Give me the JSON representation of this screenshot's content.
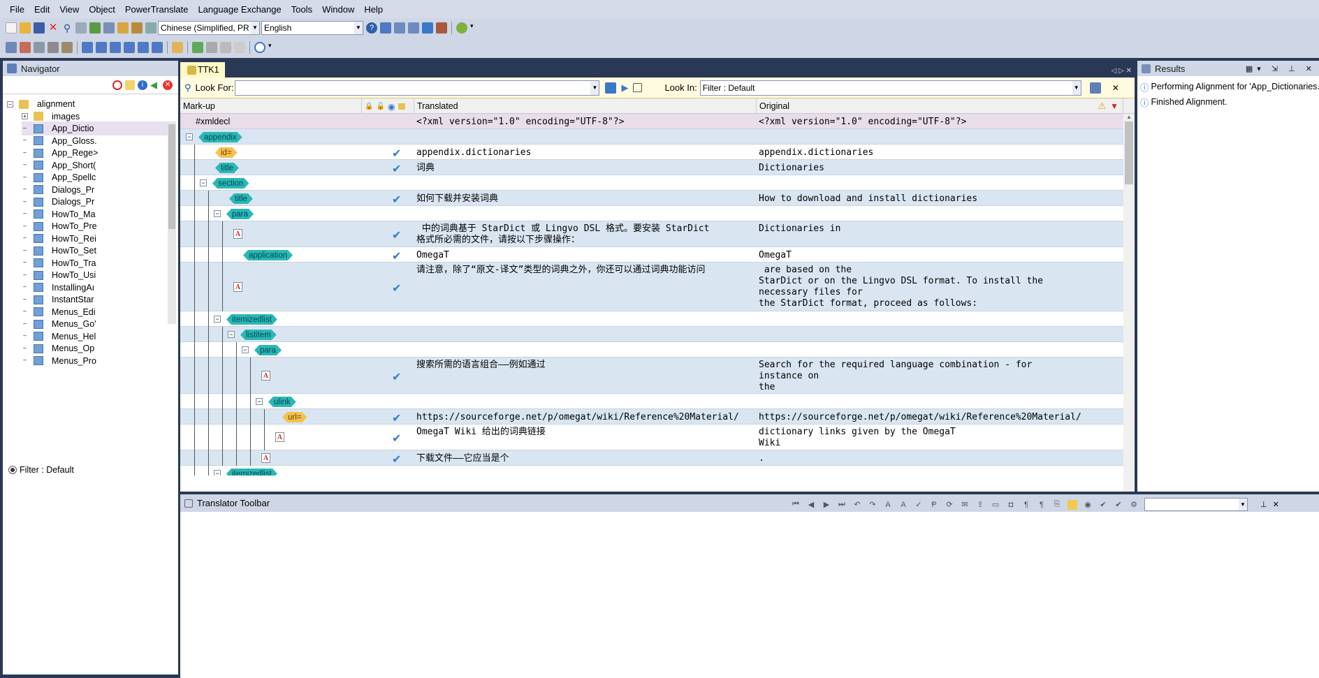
{
  "menu": [
    "File",
    "Edit",
    "View",
    "Object",
    "PowerTranslate",
    "Language Exchange",
    "Tools",
    "Window",
    "Help"
  ],
  "toolbar": {
    "source_lang": "Chinese (Simplified, PR",
    "target_lang": "English"
  },
  "navigator": {
    "title": "Navigator",
    "tree": [
      {
        "label": "alignment",
        "kind": "folder",
        "level": 0
      },
      {
        "label": "images",
        "kind": "folder",
        "level": 1
      },
      {
        "label": "App_Dictio",
        "kind": "file",
        "level": 1
      },
      {
        "label": "App_Gloss.",
        "kind": "file",
        "level": 1
      },
      {
        "label": "App_Rege>",
        "kind": "file",
        "level": 1
      },
      {
        "label": "App_Short(",
        "kind": "file",
        "level": 1
      },
      {
        "label": "App_Spellc",
        "kind": "file",
        "level": 1
      },
      {
        "label": "Dialogs_Pr",
        "kind": "file",
        "level": 1
      },
      {
        "label": "Dialogs_Pr",
        "kind": "file",
        "level": 1
      },
      {
        "label": "HowTo_Ma",
        "kind": "file",
        "level": 1
      },
      {
        "label": "HowTo_Pre",
        "kind": "file",
        "level": 1
      },
      {
        "label": "HowTo_Rei",
        "kind": "file",
        "level": 1
      },
      {
        "label": "HowTo_Set",
        "kind": "file",
        "level": 1
      },
      {
        "label": "HowTo_Tra",
        "kind": "file",
        "level": 1
      },
      {
        "label": "HowTo_Usi",
        "kind": "file",
        "level": 1
      },
      {
        "label": "InstallingAı",
        "kind": "file",
        "level": 1
      },
      {
        "label": "InstantStar",
        "kind": "file",
        "level": 1
      },
      {
        "label": "Menus_Edi",
        "kind": "file",
        "level": 1
      },
      {
        "label": "Menus_Go'",
        "kind": "file",
        "level": 1
      },
      {
        "label": "Menus_Hel",
        "kind": "file",
        "level": 1
      },
      {
        "label": "Menus_Op",
        "kind": "file",
        "level": 1
      },
      {
        "label": "Menus_Pro",
        "kind": "file",
        "level": 1
      }
    ],
    "filter_label": "Filter : Default"
  },
  "editor": {
    "tab": "TTK1",
    "look_for_label": "Look For:",
    "look_for_value": "",
    "look_in_label": "Look In:",
    "look_in_value": "Filter : Default",
    "col_markup": "Mark-up",
    "col_translated": "Translated",
    "col_original": "Original",
    "rows": [
      {
        "markup": "#xmldecl",
        "markup_kind": "text",
        "translated": "<?xml version=\"1.0\" encoding=\"UTF-8\"?>",
        "original": "<?xml version=\"1.0\" encoding=\"UTF-8\"?>",
        "check": false,
        "icon": false
      },
      {
        "markup": "appendix",
        "markup_kind": "tag",
        "translated": "",
        "original": "",
        "check": false,
        "icon": false
      },
      {
        "markup": "id=",
        "markup_kind": "ph",
        "translated": "appendix.dictionaries",
        "original": "appendix.dictionaries",
        "check": true,
        "icon": false
      },
      {
        "markup": "title",
        "markup_kind": "tag",
        "translated": "词典",
        "original": "Dictionaries",
        "check": true,
        "icon": false
      },
      {
        "markup": "section",
        "markup_kind": "tag",
        "translated": "",
        "original": "",
        "check": false,
        "icon": false
      },
      {
        "markup": "title",
        "markup_kind": "tag",
        "translated": "如何下载并安装词典",
        "original": "How to download and install dictionaries",
        "check": true,
        "icon": false
      },
      {
        "markup": "para",
        "markup_kind": "tag",
        "translated": "",
        "original": "",
        "check": false,
        "icon": false
      },
      {
        "markup": "A",
        "markup_kind": "icon",
        "translated": " 中的词典基于 StarDict 或 Lingvo DSL 格式。要安装 StarDict\n格式所必需的文件，请按以下步骤操作：",
        "original": "Dictionaries in",
        "check": true,
        "icon": true
      },
      {
        "markup": "application",
        "markup_kind": "tag",
        "translated": "OmegaT",
        "original": "OmegaT",
        "check": true,
        "icon": false
      },
      {
        "markup": "A",
        "markup_kind": "icon",
        "translated": "请注意，除了“原文-译文”类型的词典之外，你还可以通过词典功能访问",
        "original": " are based on the\nStarDict or on the Lingvo DSL format. To install the\nnecessary files for\nthe StarDict format, proceed as follows:",
        "check": true,
        "icon": true
      },
      {
        "markup": "itemizedlist",
        "markup_kind": "tag",
        "translated": "",
        "original": "",
        "check": false,
        "icon": false
      },
      {
        "markup": "listitem",
        "markup_kind": "tag",
        "translated": "",
        "original": "",
        "check": false,
        "icon": false
      },
      {
        "markup": "para",
        "markup_kind": "tag",
        "translated": "",
        "original": "",
        "check": false,
        "icon": false
      },
      {
        "markup": "A",
        "markup_kind": "icon",
        "translated": "搜索所需的语言组合——例如通过",
        "original": "Search for the required language combination - for\ninstance on\nthe",
        "check": true,
        "icon": true
      },
      {
        "markup": "ulink",
        "markup_kind": "tag",
        "translated": "",
        "original": "",
        "check": false,
        "icon": false
      },
      {
        "markup": "url=",
        "markup_kind": "ph",
        "translated": "https://sourceforge.net/p/omegat/wiki/Reference%20Material/",
        "original": "https://sourceforge.net/p/omegat/wiki/Reference%20Material/",
        "check": true,
        "icon": false
      },
      {
        "markup": "A",
        "markup_kind": "icon",
        "translated": "OmegaT Wiki 给出的词典链接",
        "original": "dictionary links given by the OmegaT\nWiki",
        "check": true,
        "icon": true
      },
      {
        "markup": "A",
        "markup_kind": "icon",
        "translated": "下载文件——它应当是个",
        "original": ".",
        "check": true,
        "icon": true
      },
      {
        "markup": "itemizedlist",
        "markup_kind": "tag",
        "translated": "",
        "original": "",
        "check": false,
        "icon": false
      }
    ]
  },
  "results": {
    "title": "Results",
    "lines": [
      "Performing Alignment for 'App_Dictionaries.xml'",
      "Finished Alignment."
    ]
  },
  "translator_toolbar": {
    "title": "Translator Toolbar"
  },
  "colors": {
    "accent": "#293955",
    "tag": "#2ab7b7",
    "placeholder": "#f3c34f",
    "row_alt": "#d9e6f2",
    "check": "#2f7bd6"
  }
}
